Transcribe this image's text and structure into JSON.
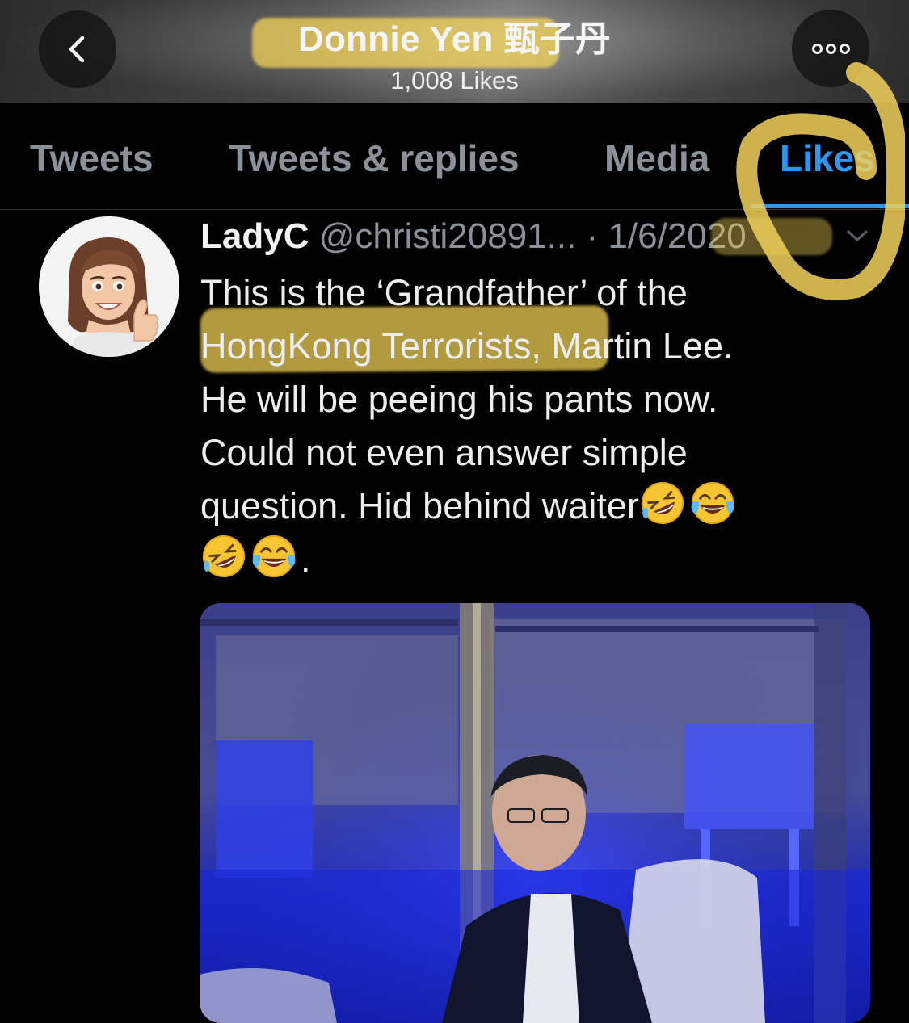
{
  "header": {
    "title": "Donnie Yen 甄子丹",
    "subtitle": "1,008 Likes",
    "back_icon": "chevron-left-icon",
    "more_icon": "more-horizontal-icon"
  },
  "tabs": [
    {
      "label": "Tweets",
      "active": false
    },
    {
      "label": "Tweets & replies",
      "active": false
    },
    {
      "label": "Media",
      "active": false
    },
    {
      "label": "Likes",
      "active": true
    }
  ],
  "tweet": {
    "name": "LadyC",
    "handle": "@christi20891...",
    "separator": " · ",
    "date": "1/6/2020",
    "lines": [
      "This is the ‘Grandfather’ of the",
      "HongKong Terrorists, Martin Lee.",
      "He will be peeing his pants now.",
      "Could not even answer simple",
      "question. Hid behind waiter"
    ],
    "last_line_suffix": ".",
    "emojis": [
      "rolling-on-floor-laughing",
      "tears-of-joy",
      "rolling-on-floor-laughing",
      "tears-of-joy"
    ]
  },
  "colors": {
    "accent": "#2b97f0",
    "highlight": "#f6d656",
    "muted": "#8b9198",
    "background": "#000000"
  }
}
